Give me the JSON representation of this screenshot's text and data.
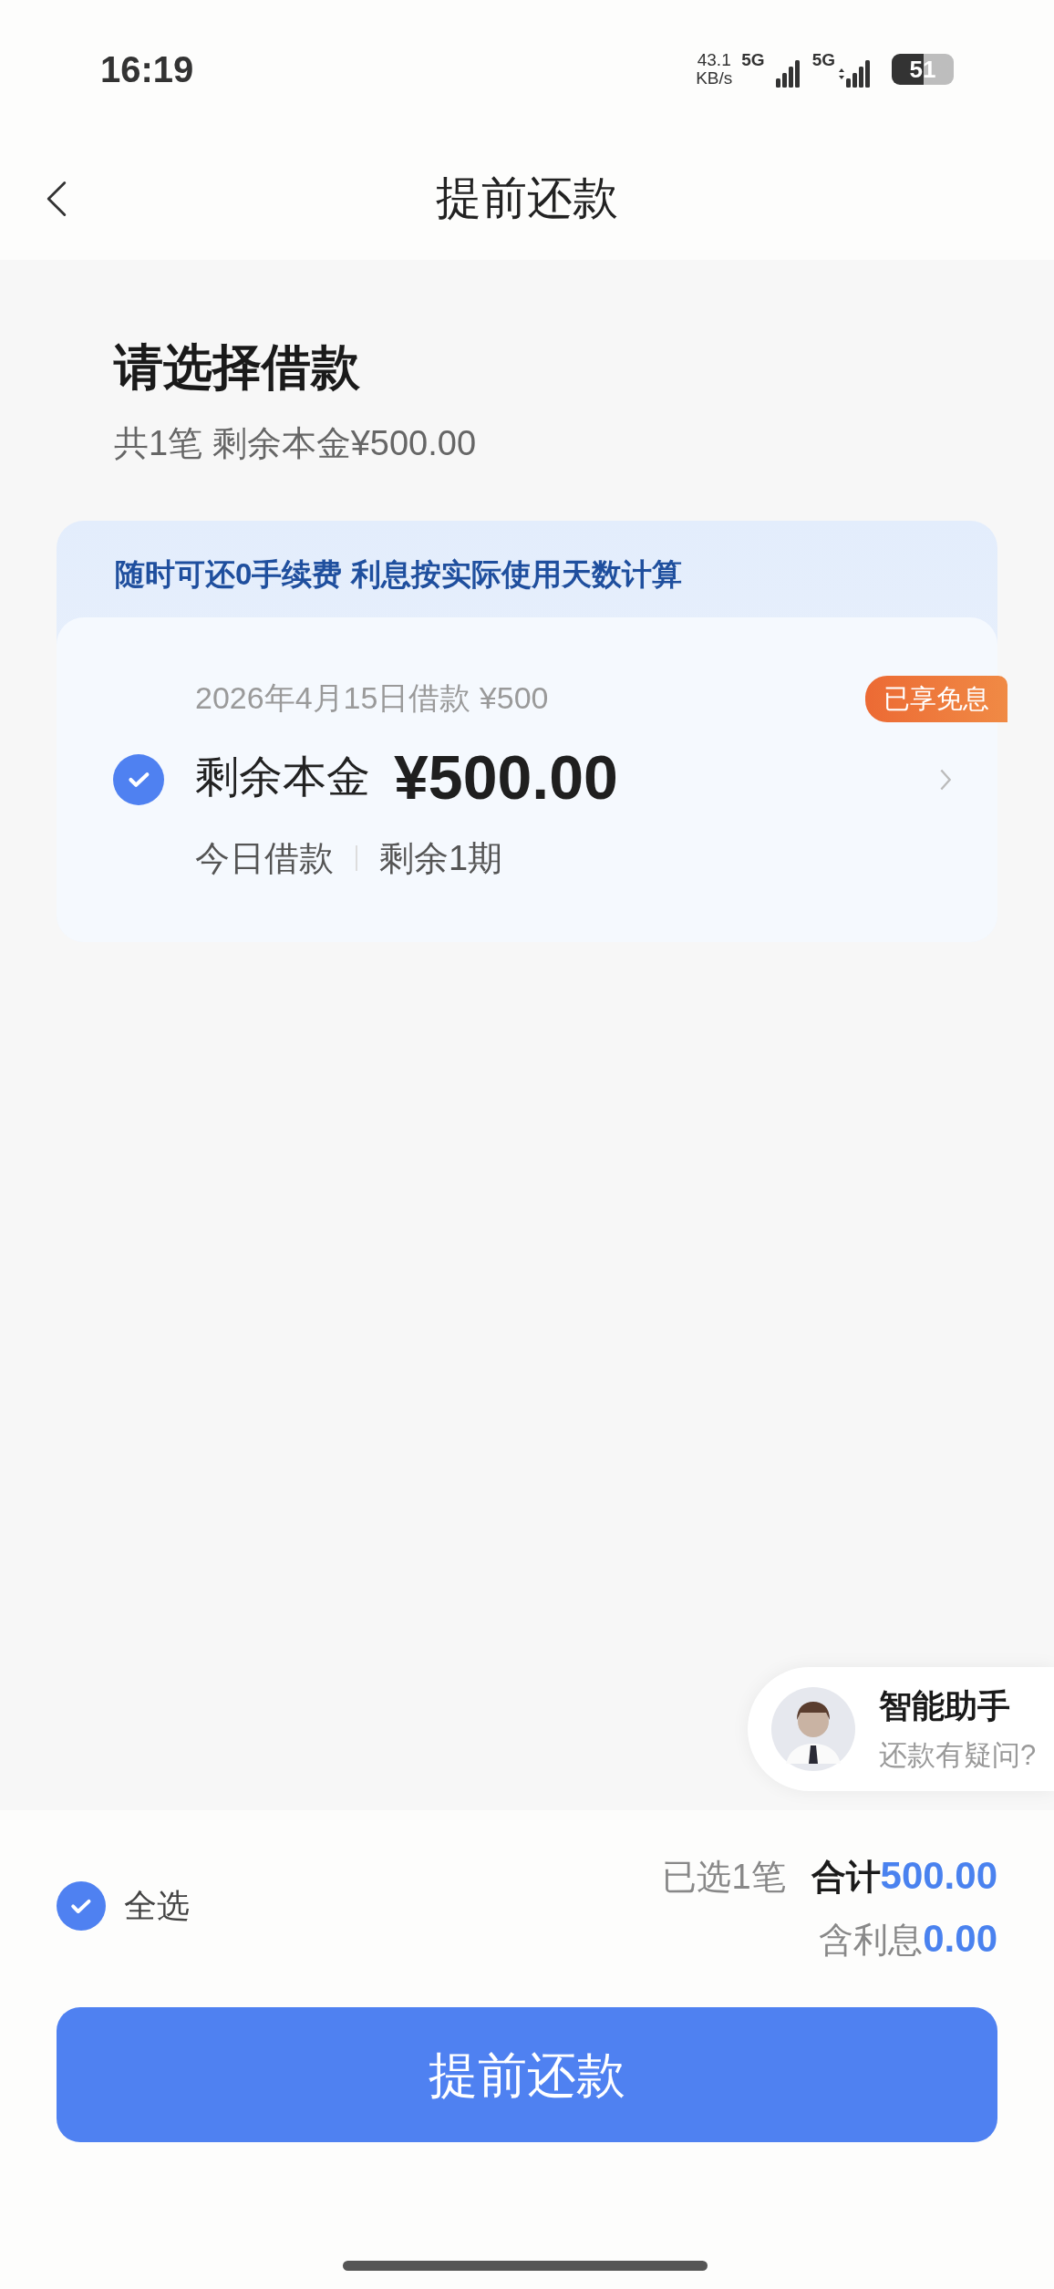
{
  "status_bar": {
    "time": "16:19",
    "speed": "43.1",
    "speed_unit": "KB/s",
    "networks": [
      "5G",
      "5G"
    ],
    "battery": "51"
  },
  "nav": {
    "title": "提前还款"
  },
  "heading": "请选择借款",
  "summary": "共1笔 剩余本金¥500.00",
  "banner": "随时可还0手续费 利息按实际使用天数计算",
  "loans": [
    {
      "date_line": "2026年4月15日借款 ¥500",
      "label": "剩余本金",
      "amount": "¥500.00",
      "tags": [
        "今日借款",
        "剩余1期"
      ],
      "badge": "已享免息",
      "selected": true
    }
  ],
  "assistant": {
    "title": "智能助手",
    "subtitle": "还款有疑问?"
  },
  "footer": {
    "select_all": {
      "label": "全选",
      "checked": true
    },
    "selected_count": "已选1笔",
    "total_label": "合计",
    "total": "500.00",
    "interest_label": "含利息",
    "interest": "0.00",
    "button": "提前还款"
  }
}
